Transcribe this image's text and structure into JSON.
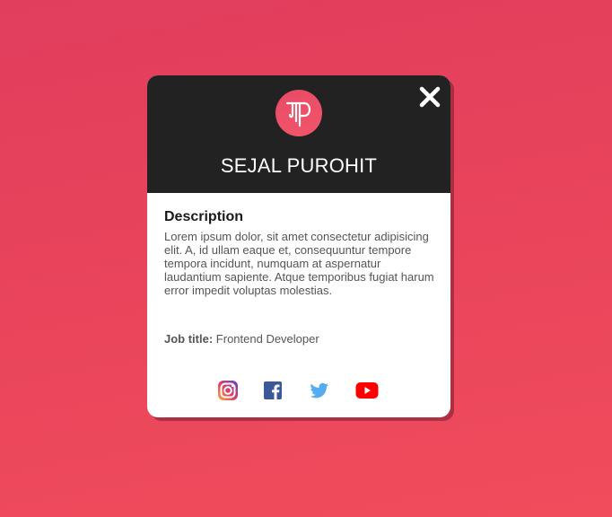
{
  "profile": {
    "name": "SEJAL PUROHIT",
    "description_heading": "Description",
    "description": "Lorem ipsum dolor, sit amet consectetur adipisicing elit. A, id ullam eaque et, consequuntur tempore tempora incidunt, numquam at aspernatur laudantium sapiente. Atque temporibus fugiat harum error impedit voluptas molestias.",
    "job_label": "Job title:",
    "job_value": "Frontend Developer"
  },
  "icons": {
    "logo": "p-monogram-logo",
    "close": "close-icon",
    "socials": [
      "instagram-icon",
      "facebook-icon",
      "twitter-icon",
      "youtube-icon"
    ]
  },
  "colors": {
    "background_top": "#e13d5d",
    "background_bottom": "#f04c5c",
    "header": "#222222",
    "card": "#ffffff",
    "logo": "#ec4e68",
    "facebook": "#3b5998",
    "twitter": "#55acee",
    "youtube": "#ff0000"
  }
}
